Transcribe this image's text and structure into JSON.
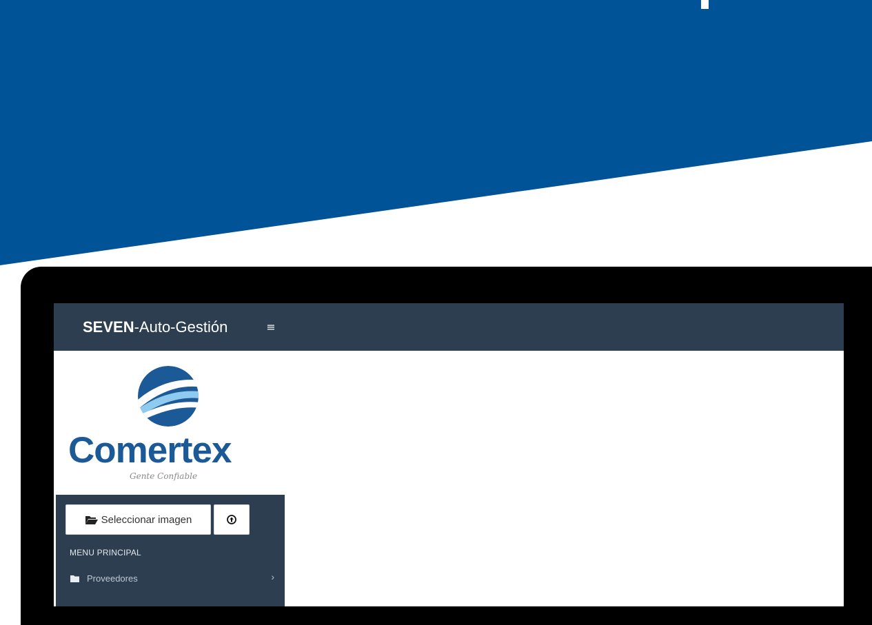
{
  "app": {
    "brand_bold": "SEVEN",
    "brand_rest": "-Auto-Gestión",
    "menu_toggle_icon": "hamburger-icon"
  },
  "logo": {
    "wordmark": "Comertex",
    "tagline": "Gente Confiable",
    "icon": "globe-swoosh-icon"
  },
  "sidebar": {
    "select_image_label": "Seleccionar imagen",
    "select_image_icon": "folder-open-icon",
    "upload_icon": "upload-circle-icon",
    "menu_header": "MENU PRINCIPAL",
    "items": [
      {
        "label": "Proveedores",
        "icon": "folder-icon",
        "chevron": "chevron-right-icon"
      }
    ]
  },
  "colors": {
    "banner_blue": "#005396",
    "header_dark": "#2c3e50",
    "logo_blue": "#1b5a97",
    "device_frame": "#000000"
  }
}
